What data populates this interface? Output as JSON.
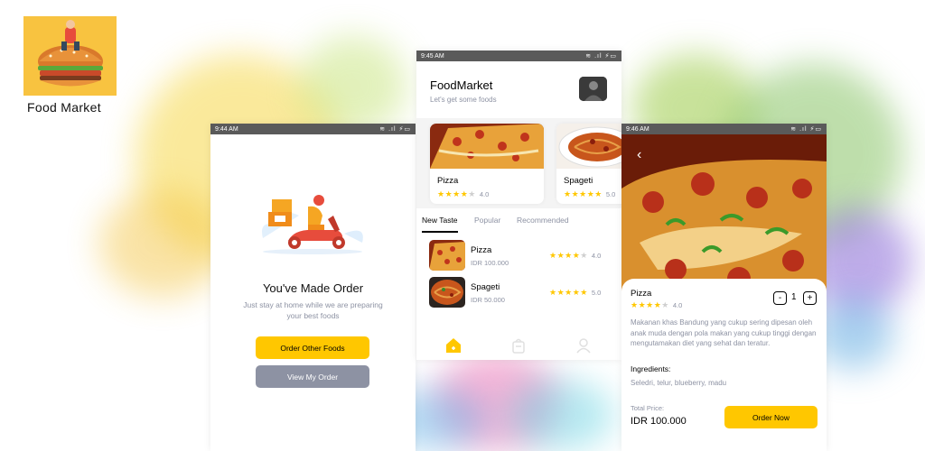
{
  "brand": {
    "caption": "Food Market"
  },
  "order_screen": {
    "time": "9:44 AM",
    "status_icons": "≋ .ıl ⚡▭",
    "title": "You've Made Order",
    "subtitle": "Just stay at home while we are preparing your best foods",
    "primary_button": "Order Other Foods",
    "secondary_button": "View My Order"
  },
  "home_screen": {
    "time": "9:45 AM",
    "status_icons": "≋ .ıl ⚡▭",
    "title": "FoodMarket",
    "subtitle": "Let's get some foods",
    "cards": [
      {
        "name": "Pizza",
        "rating": "4.0",
        "stars": 4
      },
      {
        "name": "Spageti",
        "rating": "5.0",
        "stars": 5
      }
    ],
    "tabs": [
      "New Taste",
      "Popular",
      "Recommended"
    ],
    "list": [
      {
        "name": "Pizza",
        "price": "IDR 100.000",
        "rating": "4.0",
        "stars": 4
      },
      {
        "name": "Spageti",
        "price": "IDR 50.000",
        "rating": "5.0",
        "stars": 5
      }
    ],
    "nav_icons": [
      "home-icon",
      "bag-icon",
      "profile-icon"
    ],
    "accent": "#ffc700"
  },
  "detail_screen": {
    "time": "9:46 AM",
    "status_icons": "≋ .ıl ⚡▭",
    "name": "Pizza",
    "rating": "4.0",
    "stars": 4,
    "minus": "-",
    "plus": "+",
    "quantity": "1",
    "description": "Makanan khas Bandung yang cukup sering dipesan oleh anak muda dengan pola makan yang cukup tinggi dengan mengutamakan diet yang sehat dan teratur.",
    "ingredients_title": "Ingredients:",
    "ingredients": "Seledri, telur, blueberry, madu",
    "total_label": "Total Price:",
    "total_value": "IDR 100.000",
    "order_button": "Order Now"
  }
}
